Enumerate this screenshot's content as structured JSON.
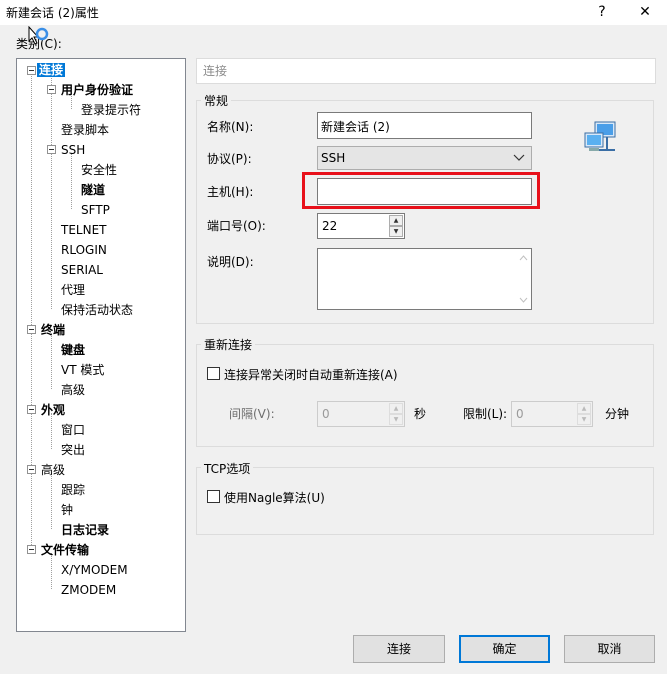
{
  "window": {
    "title": "新建会话 (2)属性",
    "help_glyph": "?",
    "close_glyph": "✕"
  },
  "category_label": "类别(C):",
  "tree": {
    "items": [
      {
        "label": "连接"
      },
      {
        "label": "用户身份验证"
      },
      {
        "label": "登录提示符"
      },
      {
        "label": "登录脚本"
      },
      {
        "label": "SSH"
      },
      {
        "label": "安全性"
      },
      {
        "label": "隧道"
      },
      {
        "label": "SFTP"
      },
      {
        "label": "TELNET"
      },
      {
        "label": "RLOGIN"
      },
      {
        "label": "SERIAL"
      },
      {
        "label": "代理"
      },
      {
        "label": "保持活动状态"
      },
      {
        "label": "终端"
      },
      {
        "label": "键盘"
      },
      {
        "label": "VT 模式"
      },
      {
        "label": "高级"
      },
      {
        "label": "外观"
      },
      {
        "label": "窗口"
      },
      {
        "label": "突出"
      },
      {
        "label": "高级"
      },
      {
        "label": "跟踪"
      },
      {
        "label": "钟"
      },
      {
        "label": "日志记录"
      },
      {
        "label": "文件传输"
      },
      {
        "label": "X/YMODEM"
      },
      {
        "label": "ZMODEM"
      }
    ]
  },
  "header": {
    "text": "连接"
  },
  "general": {
    "title": "常规",
    "name_label": "名称(N):",
    "name_value": "新建会话 (2)",
    "protocol_label": "协议(P):",
    "protocol_value": "SSH",
    "host_label": "主机(H):",
    "host_value": "",
    "port_label": "端口号(O):",
    "port_value": "22",
    "desc_label": "说明(D):",
    "desc_value": ""
  },
  "reconnect": {
    "title": "重新连接",
    "checkbox_label": "连接异常关闭时自动重新连接(A)",
    "interval_label": "间隔(V):",
    "interval_value": "0",
    "interval_unit": "秒",
    "limit_label": "限制(L):",
    "limit_value": "0",
    "limit_unit": "分钟"
  },
  "tcp": {
    "title": "TCP选项",
    "nagle_label": "使用Nagle算法(U)"
  },
  "buttons": {
    "connect": "连接",
    "ok": "确定",
    "cancel": "取消"
  },
  "colors": {
    "selection": "#0078d7",
    "highlight_box": "#e8101a"
  }
}
